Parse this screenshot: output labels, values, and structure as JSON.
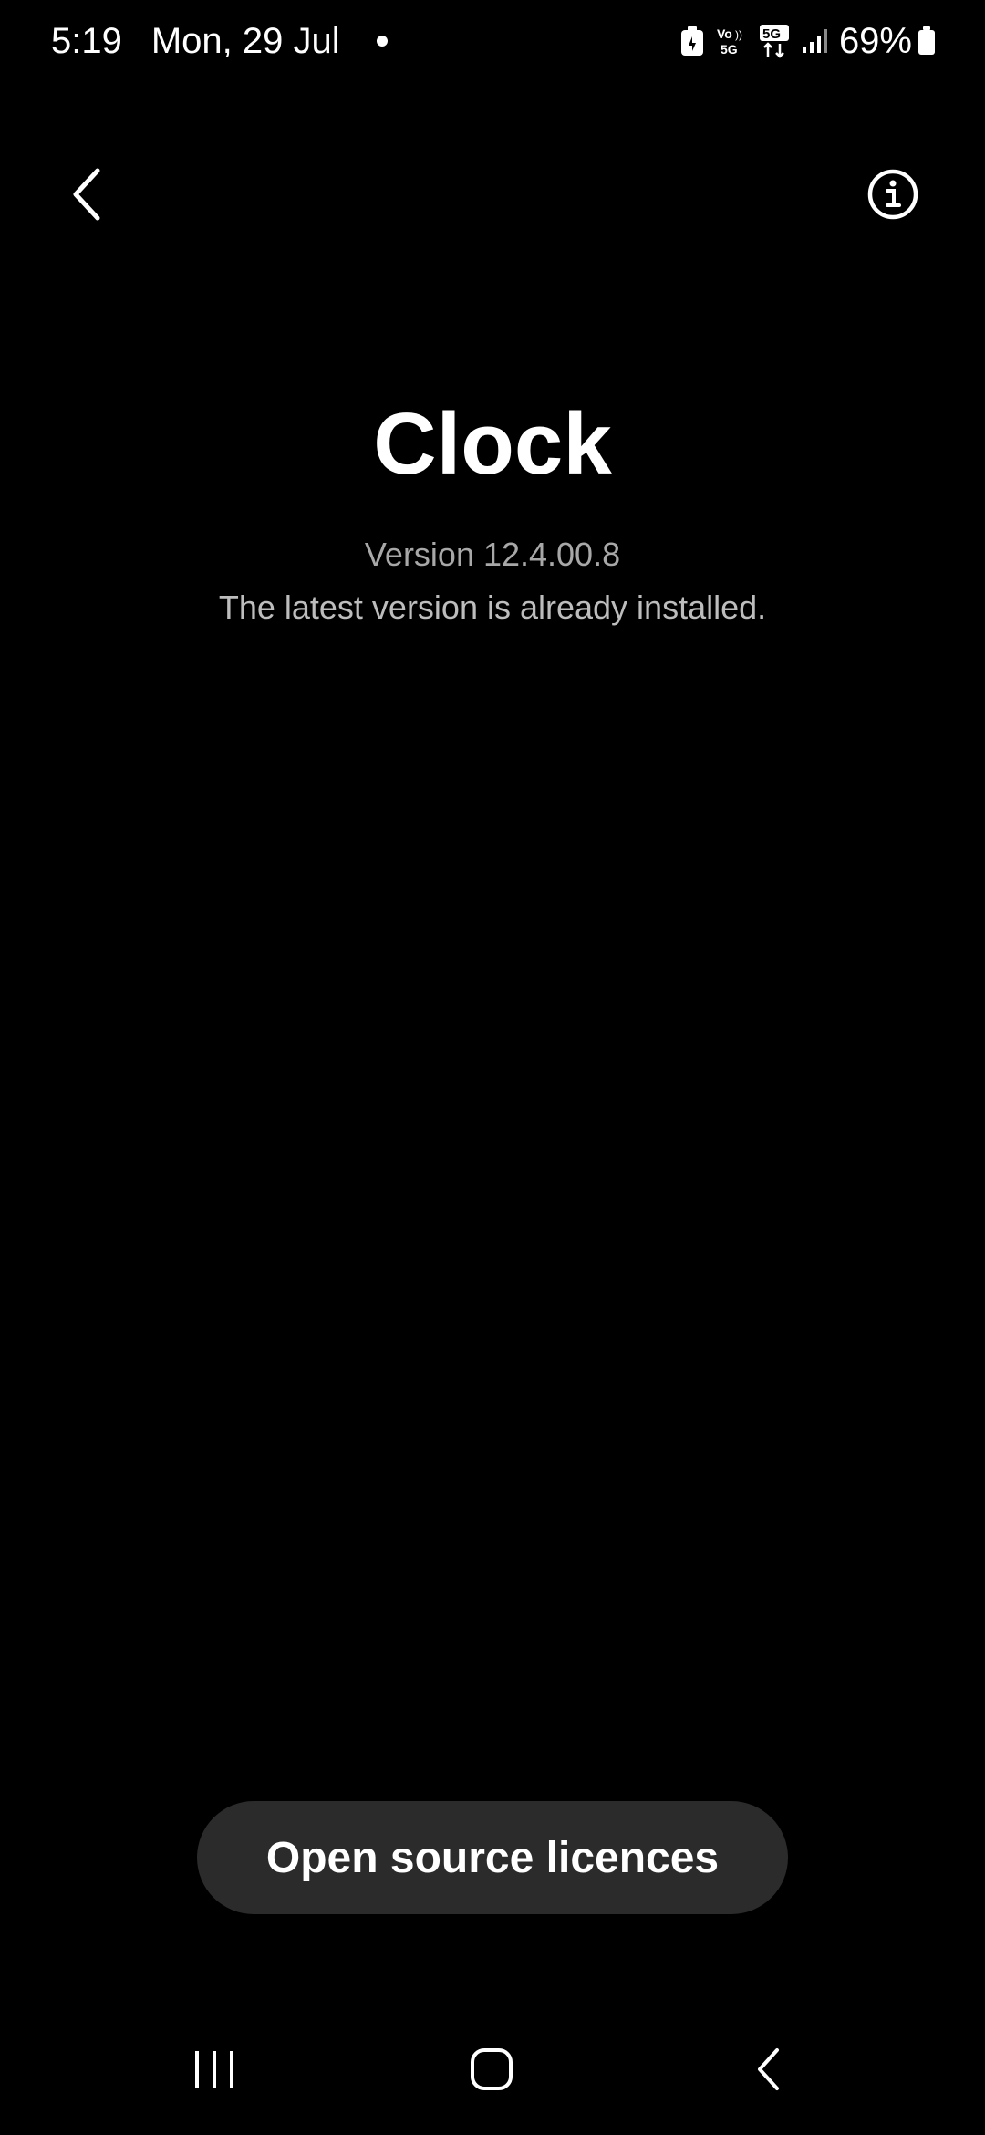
{
  "status_bar": {
    "time": "5:19",
    "date": "Mon, 29 Jul",
    "battery_percent": "69%",
    "network": "5G",
    "volte": "Vo) 5G",
    "icons": [
      "notification-dot-icon",
      "battery-saver-icon",
      "volte-icon",
      "5g-data-icon",
      "signal-icon",
      "battery-icon"
    ]
  },
  "app_bar": {
    "back_icon": "chevron-left-icon",
    "info_icon": "info-circle-icon"
  },
  "app_info": {
    "name": "Clock",
    "version": "Version 12.4.00.8",
    "update_status": "The latest version is already installed."
  },
  "actions": {
    "open_source_label": "Open source licences"
  },
  "nav_bar": {
    "icons": [
      "recents-icon",
      "home-icon",
      "back-icon"
    ]
  },
  "colors": {
    "background": "#000000",
    "text_primary": "#ffffff",
    "text_secondary": "#a8a8a8",
    "button_bg": "#2b2b2b"
  }
}
